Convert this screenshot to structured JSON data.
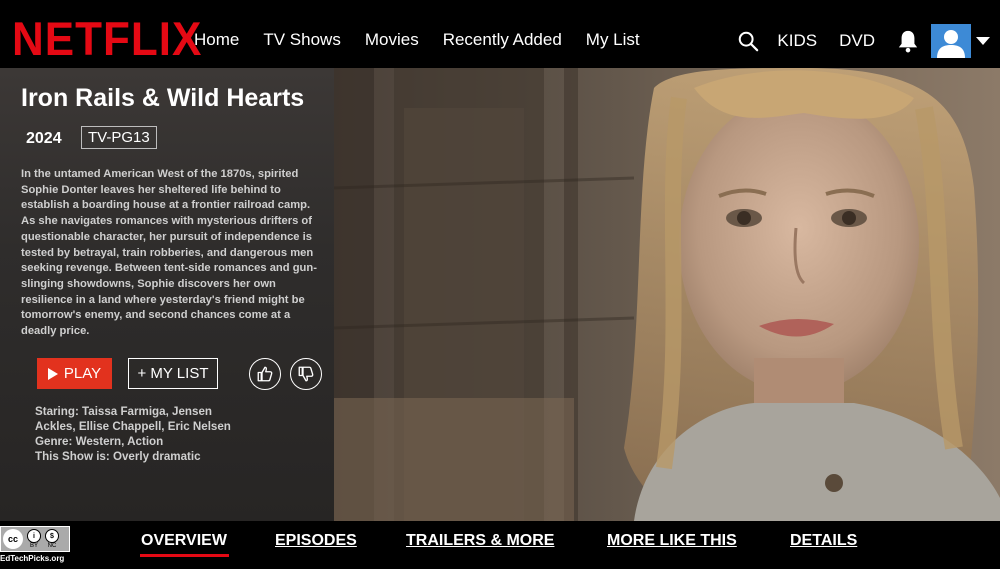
{
  "header": {
    "logo": "NETFLIX",
    "nav": [
      "Home",
      "TV Shows",
      "Movies",
      "Recently Added",
      "My List"
    ],
    "right_nav": [
      "KIDS",
      "DVD"
    ]
  },
  "show": {
    "title": "Iron Rails & Wild Hearts",
    "year": "2024",
    "rating": "TV-PG13",
    "synopsis": "In the untamed American West of the 1870s, spirited Sophie Donter leaves her sheltered life behind to establish a boarding house at a frontier railroad camp. As she navigates romances with mysterious drifters of questionable character, her pursuit of independence is tested by betrayal, train robberies, and dangerous men seeking revenge. Between tent-side romances and gun-slinging showdowns, Sophie discovers her own resilience in a land where yesterday's friend might be tomorrow's enemy, and second chances come at a deadly price.",
    "play_label": "PLAY",
    "mylist_label": "+ MY LIST",
    "starring": "Staring: Taissa Farmiga, Jensen Ackles, Ellise Chappell, Eric Nelsen",
    "genre": "Genre: Western, Action",
    "show_is": "This Show is: Overly dramatic"
  },
  "tabs": {
    "items": [
      "OVERVIEW",
      "EPISODES",
      "TRAILERS & MORE",
      "MORE LIKE THIS",
      "DETAILS"
    ],
    "active": "OVERVIEW"
  },
  "license": {
    "cc": "cc",
    "by": "BY",
    "nc": "NC",
    "site": "EdTechPicks.org"
  },
  "colors": {
    "brand": "#e50914",
    "play_button": "#e2321e",
    "avatar": "#3d8ad6"
  }
}
